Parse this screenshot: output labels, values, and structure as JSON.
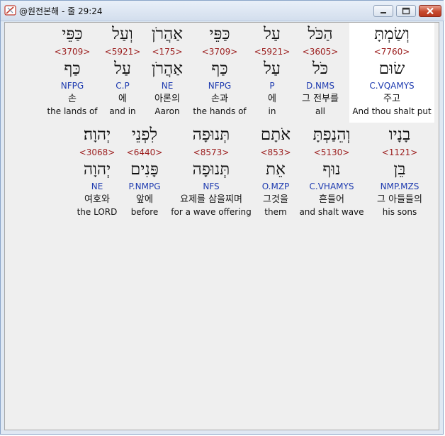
{
  "window": {
    "title": "@원전본해 - 줄 29:24"
  },
  "rows": [
    {
      "words": [
        {
          "heb": "וְשַׂמְתָּ",
          "strong": "<7760>",
          "lemma": "שׂוּם",
          "morph": "C.VQAMYS",
          "kor": "주고",
          "eng": "And thou shalt put",
          "selected": true
        },
        {
          "heb": "הַכֹּל",
          "strong": "<3605>",
          "lemma": "כֹּל",
          "morph": "D.NMS",
          "kor": "그 전부를",
          "eng": "all"
        },
        {
          "heb": "עַל",
          "strong": "<5921>",
          "lemma": "עַל",
          "morph": "P",
          "kor": "에",
          "eng": "in"
        },
        {
          "heb": "כַּפֵּי",
          "strong": "<3709>",
          "lemma": "כַּף",
          "morph": "NFPG",
          "kor": "손과",
          "eng": "the hands of"
        },
        {
          "heb": "אַהֲרֹן",
          "strong": "<175>",
          "lemma": "אַהֲרֹן",
          "morph": "NE",
          "kor": "아론의",
          "eng": "Aaron"
        },
        {
          "heb": "וְעַל",
          "strong": "<5921>",
          "lemma": "עַל",
          "morph": "C.P",
          "kor": "에",
          "eng": "and in"
        },
        {
          "heb": "כַּפֵּי",
          "strong": "<3709>",
          "lemma": "כַּף",
          "morph": "NFPG",
          "kor": "손",
          "eng": "the lands of"
        }
      ]
    },
    {
      "words": [
        {
          "heb": "בָנָיו",
          "strong": "<1121>",
          "lemma": "בֵּן",
          "morph": "NMP.MZS",
          "kor": "그 아들들의",
          "eng": "his sons"
        },
        {
          "heb": "וְהֵנַפְתָּ",
          "strong": "<5130>",
          "lemma": "נוּף",
          "morph": "C.VHAMYS",
          "kor": "흔들어",
          "eng": "and shalt wave"
        },
        {
          "heb": "אֹתָם",
          "strong": "<853>",
          "lemma": "אֵת",
          "morph": "O.MZP",
          "kor": "그것을",
          "eng": "them"
        },
        {
          "heb": "תְּנוּפָה",
          "strong": "<8573>",
          "lemma": "תְּנוּפָה",
          "morph": "NFS",
          "kor": "요제를 삼을찌며",
          "eng": "for a wave offering"
        },
        {
          "heb": "לִפְנֵי",
          "strong": "<6440>",
          "lemma": "פָּנִים",
          "morph": "P.NMPG",
          "kor": "앞에",
          "eng": "before"
        },
        {
          "heb": "יְהוָה׃",
          "strong": "<3068>",
          "lemma": "יְהוָה",
          "morph": "NE",
          "kor": "여호와",
          "eng": "the LORD"
        }
      ]
    }
  ]
}
